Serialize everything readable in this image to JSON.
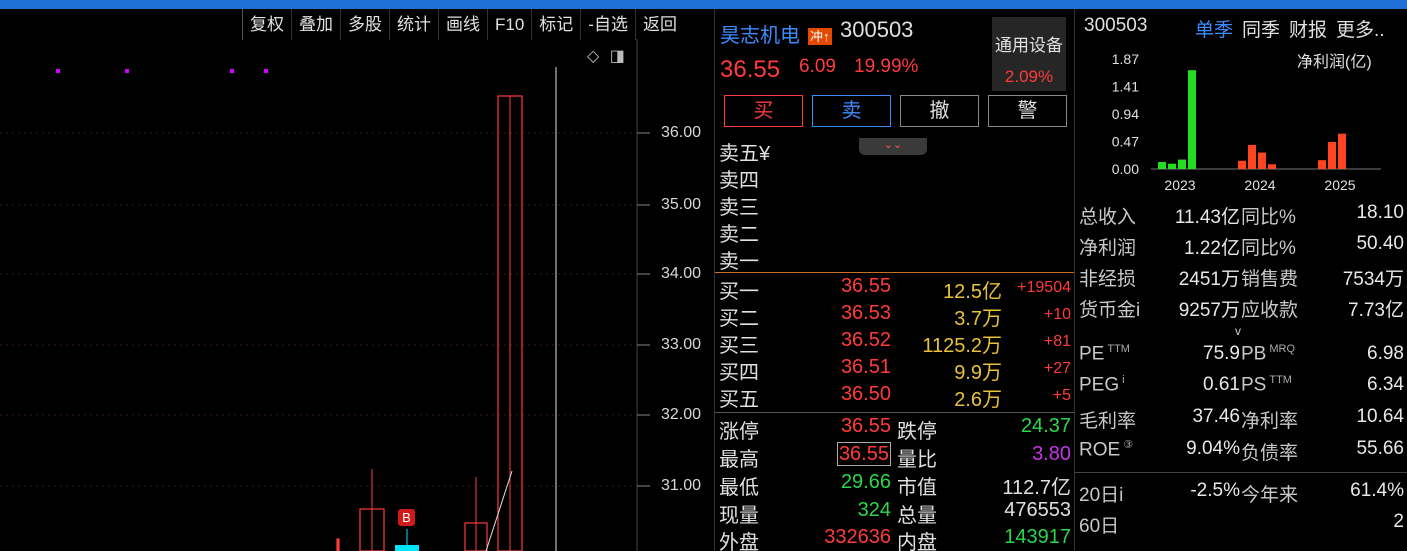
{
  "toolbar": {
    "items": [
      "复权",
      "叠加",
      "多股",
      "统计",
      "画线",
      "F10",
      "标记",
      "-自选",
      "返回"
    ]
  },
  "chart": {
    "price_labels": [
      "36.00",
      "35.00",
      "34.00",
      "33.00",
      "32.00",
      "31.00"
    ],
    "marker_b": "B",
    "icons": [
      "diamond-icon",
      "panel-toggle-icon"
    ],
    "colors": {
      "up": "#ff3b3b",
      "down": "#00e5ff",
      "marker": "#d400ff"
    }
  },
  "quote": {
    "name": "昊志机电",
    "badge": "冲↑",
    "code": "300503",
    "sector": "通用设备",
    "sector_pct": "2.09%",
    "price": "36.55",
    "change": "6.09",
    "change_pct": "19.99%",
    "buttons": [
      "买",
      "卖",
      "撤",
      "警"
    ]
  },
  "asks": [
    {
      "label": "卖五¥"
    },
    {
      "label": "卖四"
    },
    {
      "label": "卖三"
    },
    {
      "label": "卖二"
    },
    {
      "label": "卖一"
    }
  ],
  "bids": [
    {
      "label": "买一",
      "price": "36.55",
      "vol": "12.5亿",
      "delta": "+19504"
    },
    {
      "label": "买二",
      "price": "36.53",
      "vol": "3.7万",
      "delta": "+10"
    },
    {
      "label": "买三",
      "price": "36.52",
      "vol": "1125.2万",
      "delta": "+81"
    },
    {
      "label": "买四",
      "price": "36.51",
      "vol": "9.9万",
      "delta": "+27"
    },
    {
      "label": "买五",
      "price": "36.50",
      "vol": "2.6万",
      "delta": "+5"
    }
  ],
  "stats": [
    {
      "l1": "涨停",
      "v1": "36.55",
      "l2": "跌停",
      "v2": "24.37"
    },
    {
      "l1": "最高",
      "v1": "36.55",
      "l2": "量比",
      "v2": "3.80"
    },
    {
      "l1": "最低",
      "v1": "29.66",
      "l2": "市值",
      "v2": "112.7亿"
    },
    {
      "l1": "现量",
      "v1": "324",
      "l2": "总量",
      "v2": "476553"
    },
    {
      "l1": "外盘",
      "v1": "332636",
      "l2": "内盘",
      "v2": "143917"
    }
  ],
  "finance": {
    "code": "300503",
    "tabs": [
      "单季",
      "同季",
      "财报",
      "更多.."
    ],
    "mini_chart_label": "净利润(亿)",
    "chart_data": {
      "type": "bar",
      "ylabel": "净利润(亿)",
      "yticks": [
        "1.87",
        "1.41",
        "0.94",
        "0.47",
        "0.00"
      ],
      "ylim": [
        0,
        1.87
      ],
      "x_labels": [
        "2023",
        "2024",
        "2025"
      ],
      "series": [
        {
          "values": [
            0.12,
            0.09,
            0.16,
            1.68
          ],
          "color": "#22dd22"
        },
        {
          "values": [
            0.14,
            0.41,
            0.28,
            0.08
          ],
          "color": "#ff4422"
        },
        {
          "values": [
            0.15,
            0.46,
            0.6
          ],
          "color": "#ff4422"
        }
      ]
    },
    "rows": [
      {
        "a": "总收入",
        "b": "11.43亿",
        "c": "同比%",
        "e": "18.10"
      },
      {
        "a": "净利润",
        "b": "1.22亿",
        "c": "同比%",
        "e": "50.40"
      },
      {
        "a": "非经损",
        "b": "2451万",
        "c": "销售费",
        "e": "7534万"
      },
      {
        "a": "货币金i",
        "b": "9257万",
        "c": "应收款",
        "e": "7.73亿"
      }
    ],
    "chevron": "v",
    "valuation": [
      {
        "a": "PE",
        "asup": "TTM",
        "b": "75.9",
        "c": "PB",
        "csup": "MRQ",
        "e": "6.98"
      },
      {
        "a": "PEG",
        "asup": "i",
        "b": "0.61",
        "c": "PS",
        "csup": "TTM",
        "e": "6.34"
      },
      {
        "a": "毛利率",
        "asup": "",
        "b": "37.46",
        "c": "净利率",
        "csup": "",
        "e": "10.64"
      },
      {
        "a": "ROE",
        "asup": "③",
        "b": "9.04%",
        "c": "负债率",
        "csup": "",
        "e": "55.66"
      }
    ],
    "periods": [
      {
        "a": "20日i",
        "b": "-2.5%",
        "c": "今年来",
        "e": "61.4%"
      },
      {
        "a": "60日",
        "b": "",
        "c": "",
        "e": "2"
      }
    ]
  }
}
